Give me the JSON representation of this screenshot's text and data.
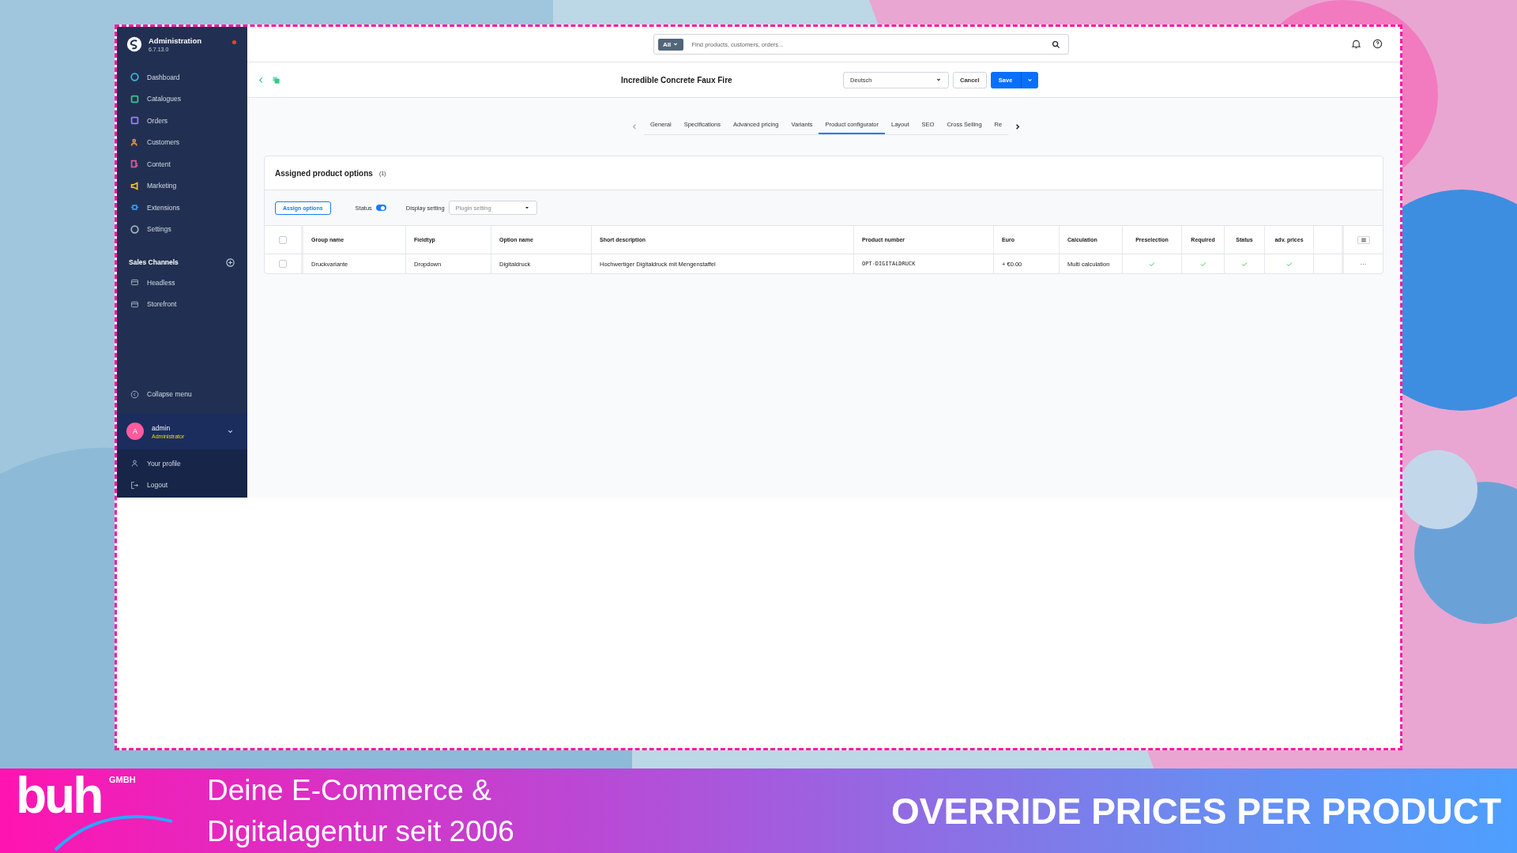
{
  "sidebar": {
    "title": "Administration",
    "version": "6.7.13.0",
    "notification": true,
    "items": [
      {
        "label": "Dashboard",
        "color": "#3fb6d8"
      },
      {
        "label": "Catalogues",
        "color": "#37c88a"
      },
      {
        "label": "Orders",
        "color": "#9a84f0"
      },
      {
        "label": "Customers",
        "color": "#f08a3c"
      },
      {
        "label": "Content",
        "color": "#e2559a"
      },
      {
        "label": "Marketing",
        "color": "#f5c518"
      },
      {
        "label": "Extensions",
        "color": "#2f9af2"
      },
      {
        "label": "Settings",
        "color": "#aab4c4"
      }
    ],
    "sales_channels_title": "Sales Channels",
    "sales_channels": [
      {
        "label": "Headless"
      },
      {
        "label": "Storefront"
      }
    ],
    "collapse": "Collapse menu",
    "user": {
      "avatar": "A",
      "name": "admin",
      "role": "Administrator"
    },
    "user_menu": [
      {
        "label": "Your profile"
      },
      {
        "label": "Logout"
      }
    ]
  },
  "search": {
    "filter": "All",
    "placeholder": "Find products, customers, orders..."
  },
  "page": {
    "title": "Incredible Concrete Faux Fire",
    "language": "Deutsch",
    "cancel": "Cancel",
    "save": "Save"
  },
  "tabs": [
    {
      "label": "General",
      "selected": false
    },
    {
      "label": "Specifications",
      "selected": false
    },
    {
      "label": "Advanced pricing",
      "selected": false
    },
    {
      "label": "Variants",
      "selected": false
    },
    {
      "label": "Product configurator",
      "selected": true
    },
    {
      "label": "Layout",
      "selected": false
    },
    {
      "label": "SEO",
      "selected": false
    },
    {
      "label": "Cross Selling",
      "selected": false
    },
    {
      "label": "Re",
      "selected": false
    }
  ],
  "card": {
    "title": "Assigned product options",
    "count": "(1)",
    "assign_button": "Assign options",
    "status_label": "Status",
    "status_on": true,
    "display_label": "Display setting",
    "display_placeholder": "Plugin setting"
  },
  "table": {
    "select_all_checked": false,
    "columns": [
      "Group name",
      "Fieldtyp",
      "Option name",
      "Short description",
      "Product number",
      "Euro",
      "Calculation",
      "Preselection",
      "Required",
      "Status",
      "adv. prices"
    ],
    "rows": [
      {
        "cells": [
          "Druckvariante",
          "Dropdown",
          "Digitaldruck",
          "Hochwertiger Digitaldruck mit Mengenstaffel",
          "OPT-DIGITALDRUCK",
          "+ €0.00",
          "Multi calculation"
        ],
        "preselection": true,
        "required": true,
        "status": true,
        "adv_prices": true,
        "checked": false,
        "actions": "···"
      }
    ]
  },
  "banner": {
    "logo": "buh",
    "logo_suffix": "GMBH",
    "tagline": [
      "Deine E-Commerce &",
      "Digitalagentur seit 2006"
    ],
    "headline": "OVERRIDE PRICES PER PRODUCT"
  }
}
